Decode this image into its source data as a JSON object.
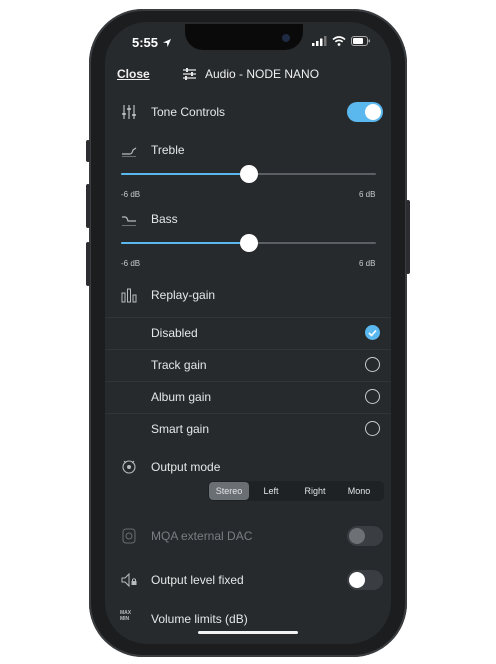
{
  "status_bar": {
    "time": "5:55"
  },
  "header": {
    "close_label": "Close",
    "title": "Audio - NODE NANO"
  },
  "tone_controls": {
    "label": "Tone Controls",
    "enabled": true
  },
  "treble": {
    "label": "Treble",
    "min_label": "-6 dB",
    "max_label": "6 dB",
    "value_db": 0
  },
  "bass": {
    "label": "Bass",
    "min_label": "-6 dB",
    "max_label": "6 dB",
    "value_db": 0
  },
  "replay_gain": {
    "label": "Replay-gain",
    "options": [
      {
        "label": "Disabled",
        "selected": true
      },
      {
        "label": "Track gain",
        "selected": false
      },
      {
        "label": "Album gain",
        "selected": false
      },
      {
        "label": "Smart gain",
        "selected": false
      }
    ]
  },
  "output_mode": {
    "label": "Output mode",
    "options": [
      "Stereo",
      "Left",
      "Right",
      "Mono"
    ],
    "selected": "Stereo"
  },
  "mqa": {
    "label": "MQA external DAC",
    "enabled": false,
    "disabled": true
  },
  "output_level_fixed": {
    "label": "Output level fixed",
    "enabled": false
  },
  "volume_limits": {
    "label": "Volume limits (dB)",
    "icon_top": "MAX",
    "icon_bottom": "MIN"
  },
  "colors": {
    "accent": "#5bb8ef",
    "background": "#262a2d"
  }
}
